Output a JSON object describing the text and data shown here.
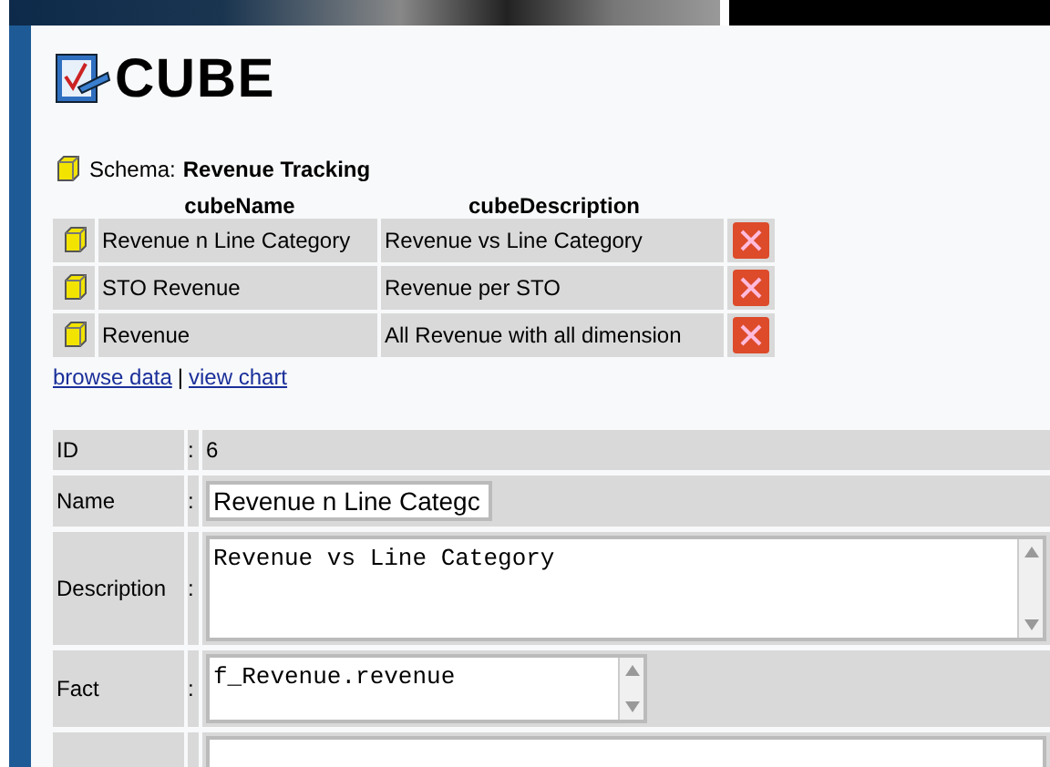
{
  "header": {
    "title": "CUBE"
  },
  "schema": {
    "label": "Schema:",
    "name": "Revenue Tracking"
  },
  "cube_table": {
    "columns": [
      "cubeName",
      "cubeDescription"
    ],
    "rows": [
      {
        "name": "Revenue n Line Category",
        "description": "Revenue vs Line Category"
      },
      {
        "name": "STO Revenue",
        "description": "Revenue per STO"
      },
      {
        "name": "Revenue",
        "description": "All Revenue with all dimension"
      }
    ]
  },
  "links": [
    {
      "label": "browse data",
      "kind": "link"
    },
    {
      "label": "|",
      "kind": "separator"
    },
    {
      "label": "view chart",
      "kind": "link"
    }
  ],
  "form": [
    {
      "label": "ID",
      "separator": ":",
      "kind": "text",
      "value": "6"
    },
    {
      "label": "Name",
      "separator": ":",
      "kind": "input",
      "value": "Revenue n Line Categc"
    },
    {
      "label": "Description",
      "separator": ":",
      "kind": "textarea",
      "value": "Revenue vs Line Category"
    },
    {
      "label": "Fact",
      "separator": ":",
      "kind": "small-textarea",
      "value": "f_Revenue.revenue"
    },
    {
      "kind": "cut-textarea"
    }
  ]
}
